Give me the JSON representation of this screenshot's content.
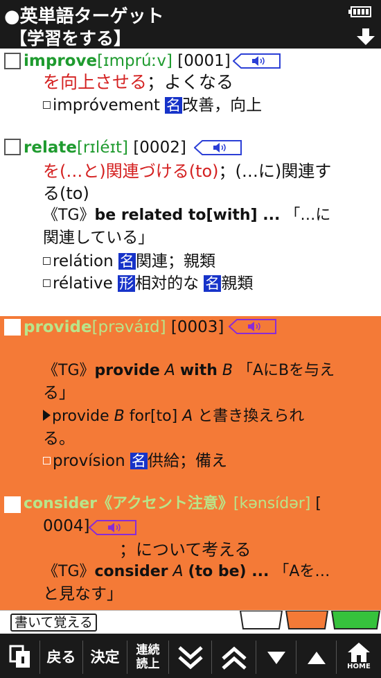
{
  "header": {
    "title": "●英単語ターゲット",
    "mode": "【学習をする】"
  },
  "entries": [
    {
      "word": "improve",
      "pron": "[ɪmprúːv]",
      "number": "[0001]",
      "lines": {
        "meaning": "を向上させる",
        "meaning2": "；よくなる",
        "derived_word": "imprόvement",
        "derived_pos": "名",
        "derived_meaning": "改善，向上"
      }
    },
    {
      "word": "relate",
      "pron": "[rɪléɪt]",
      "number": "[0002]",
      "lines": {
        "meaning": "を(…と)関連づける(to)",
        "meaning2": "；(…に)関連す",
        "meaning3": "る(to)",
        "tg_prefix": "《TG》",
        "tg_phrase": "be related to[with] ...",
        "tg_ja": "「…に",
        "tg_ja2": "関連している」",
        "d1_word": "relátion",
        "d1_pos": "名",
        "d1_meaning": "関連；親類",
        "d2_word": "rélative",
        "d2_pos": "形",
        "d2_meaning": "相対的な",
        "d2_pos2": "名",
        "d2_meaning2": "親類"
      }
    },
    {
      "word": "provide",
      "pron": "[prəváɪd]",
      "number": "[0003]",
      "lines": {
        "tg_prefix": "《TG》",
        "tg_a": "provide",
        "tg_b": "A",
        "tg_c": "with",
        "tg_d": "B",
        "tg_ja": "「AにBを与え",
        "tg_ja2": "る」",
        "alt_a": "provide",
        "alt_b": "B",
        "alt_c": "for[to]",
        "alt_d": "A",
        "alt_ja": "と書き換えられ",
        "alt_ja2": "る。",
        "d1_word": "provísion",
        "d1_pos": "名",
        "d1_meaning": "供給；備え"
      }
    },
    {
      "word": "consider",
      "accent_note": "《アクセント注意》",
      "pron": "[kənsídər]",
      "number_open": "[",
      "number": "0004]",
      "lines": {
        "meaning": "；について考える",
        "tg_prefix": "《TG》",
        "tg_a": "consider",
        "tg_b": "A",
        "tg_c": "(to be) ...",
        "tg_ja": "「Aを…",
        "tg_ja2": "と見なす」"
      }
    }
  ],
  "writebar": {
    "write_label": "書いて覚える"
  },
  "footer": {
    "back_label": "戻る",
    "ok_label": "決定",
    "continuous_label_1": "連続",
    "continuous_label_2": "読上",
    "home_label": "HOME"
  },
  "colors": {
    "header_bg": "#1a1a1a",
    "headword_green": "#1f9b2f",
    "meaning_red": "#d42020",
    "highlight_orange": "#f47a37",
    "pos_badge_blue": "#1733c9",
    "tab_green": "#36c23c"
  }
}
